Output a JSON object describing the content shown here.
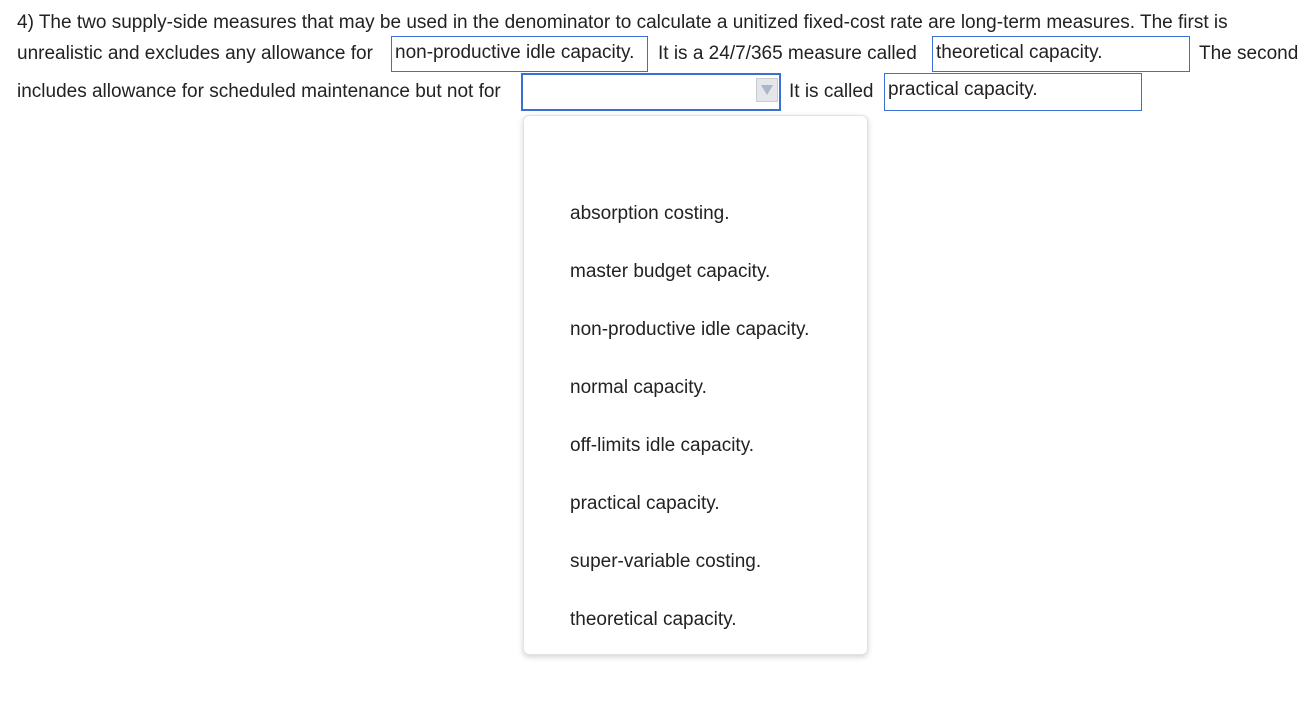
{
  "question": {
    "line1": "4) The two supply-side measures that may be used in the denominator to calculate a unitized fixed-cost rate are long-term measures. The first is",
    "line2_prefix": "unrealistic and excludes any allowance for",
    "line2_middle": "It is a 24/7/365 measure called",
    "line2_suffix": "The second",
    "line3_prefix": "includes allowance for scheduled maintenance but not for",
    "line3_middle": "It is called"
  },
  "answers": {
    "blank1": "non-productive idle capacity.",
    "blank2": "theoretical capacity.",
    "blank3": "",
    "blank4": "practical capacity."
  },
  "dropdown": {
    "options": [
      "absorption costing.",
      "master budget capacity.",
      "non-productive idle capacity.",
      "normal capacity.",
      "off-limits idle capacity.",
      "practical capacity.",
      "super-variable costing.",
      "theoretical capacity."
    ]
  },
  "colors": {
    "border_accent": "#3b6fd1",
    "text": "#222222",
    "arrow_fill": "#a9b6cc"
  },
  "icons": {
    "select_arrow": "chevron-down-icon"
  }
}
